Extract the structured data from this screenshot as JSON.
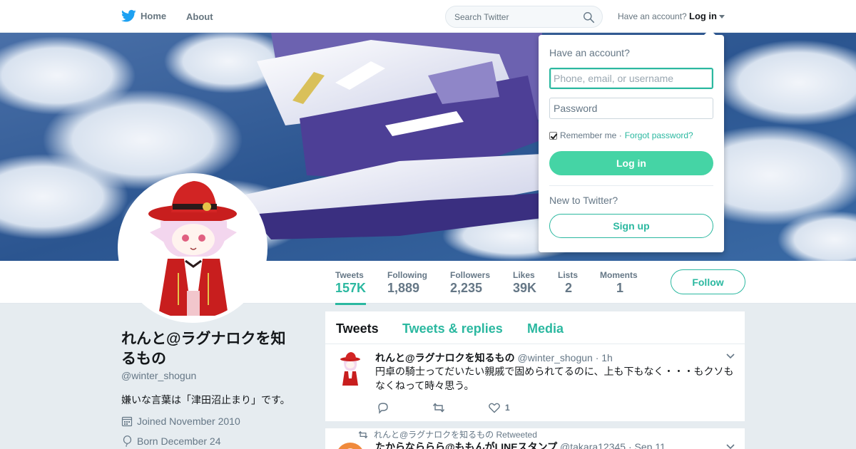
{
  "nav": {
    "home_label": "Home",
    "about_label": "About",
    "search_placeholder": "Search Twitter",
    "have_account": "Have an account?",
    "login_label": "Log in"
  },
  "profile": {
    "name": "れんと@ラグナロクを知るもの",
    "handle": "@winter_shogun",
    "bio": "嫌いな言葉は「津田沼止まり」です。",
    "joined": "Joined November 2010",
    "born": "Born December 24"
  },
  "stats": [
    {
      "label": "Tweets",
      "value": "157K"
    },
    {
      "label": "Following",
      "value": "1,889"
    },
    {
      "label": "Followers",
      "value": "2,235"
    },
    {
      "label": "Likes",
      "value": "39K"
    },
    {
      "label": "Lists",
      "value": "2"
    },
    {
      "label": "Moments",
      "value": "1"
    }
  ],
  "follow_label": "Follow",
  "timeline": {
    "tabs": [
      "Tweets",
      "Tweets & replies",
      "Media"
    ],
    "tweets": [
      {
        "fullname": "れんと@ラグナロクを知るもの",
        "screenname": "@winter_shogun",
        "time": "· 1h",
        "text": "円卓の騎士ってだいたい親戚で固められてるのに、上も下もなく・・・もクソもなくねって時々思う。",
        "likes": "1"
      },
      {
        "context": "れんと@ラグナロクを知るもの Retweeted",
        "fullname": "たからなららら@ももんがLINEスタンプ",
        "screenname": "@takara12345",
        "time": "· Sep 11"
      }
    ]
  },
  "login_dropdown": {
    "title": "Have an account?",
    "username_placeholder": "Phone, email, or username",
    "password_placeholder": "Password",
    "remember_label": "Remember me ·",
    "remember_checked": true,
    "forgot_label": "Forgot password?",
    "login_button": "Log in",
    "new_label": "New to Twitter?",
    "signup_button": "Sign up"
  },
  "colors": {
    "accent": "#2bb8a0",
    "login_button": "#45d4a5",
    "twitter_blue": "#1da1f2"
  },
  "icons": [
    "twitter-bird-icon",
    "search-icon",
    "caret-down-icon",
    "calendar-icon",
    "balloon-icon",
    "reply-icon",
    "retweet-icon",
    "like-icon",
    "chevron-down-icon"
  ]
}
